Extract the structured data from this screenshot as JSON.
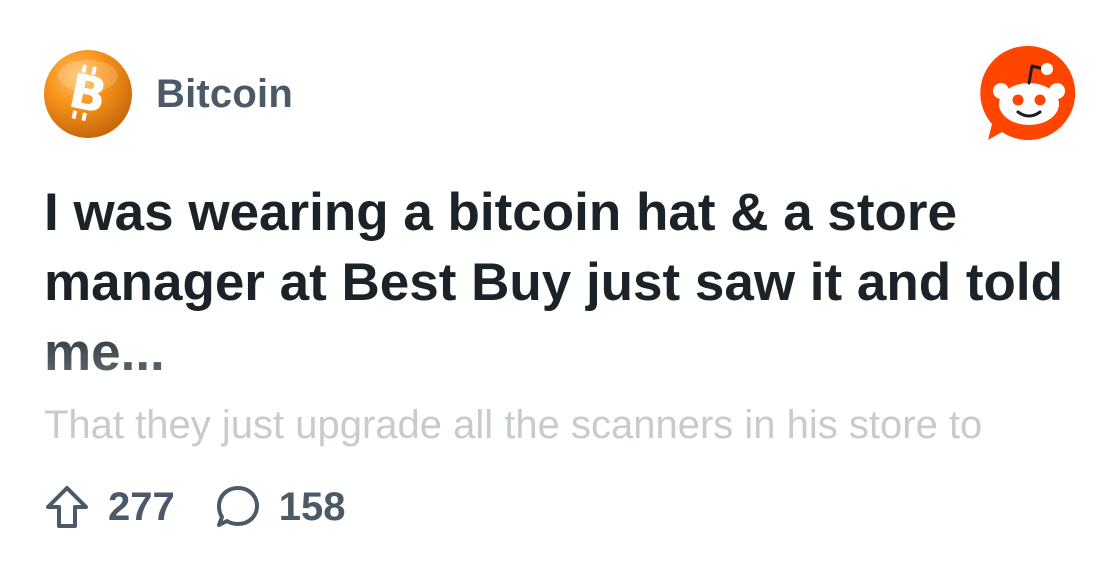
{
  "subreddit": {
    "name": "Bitcoin",
    "avatar_icon": "bitcoin-logo-icon",
    "avatar_color": "#f7931a"
  },
  "brand": {
    "icon": "reddit-logo-icon",
    "color": "#ff4500"
  },
  "post": {
    "title": "I was wearing a bitcoin hat & a store manager at Best Buy just saw it and told me...",
    "body_preview": "That they just upgrade all the scanners in his store to"
  },
  "stats": {
    "upvotes": "277",
    "upvote_icon": "upvote-arrow-icon",
    "comments": "158",
    "comment_icon": "comment-bubble-icon"
  },
  "colors": {
    "title": "#1c2328",
    "meta": "#4b5a66",
    "body_fade": "#c7cbcf"
  }
}
